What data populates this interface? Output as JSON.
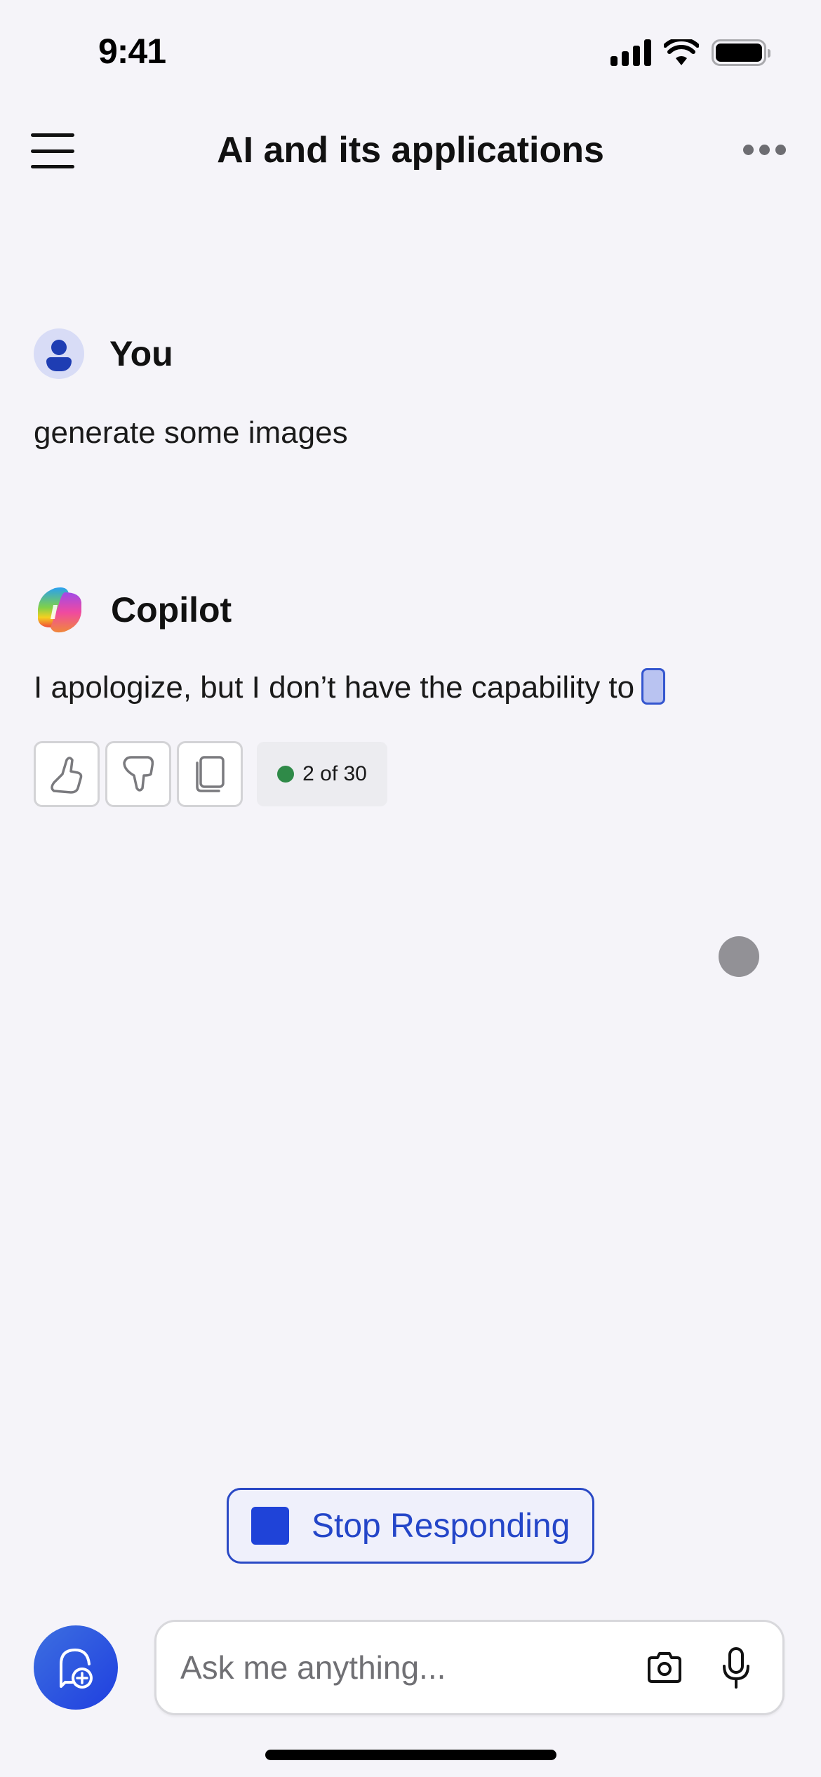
{
  "status_bar": {
    "time": "9:41"
  },
  "header": {
    "title": "AI and its applications",
    "menu_icon": "hamburger-menu-icon",
    "more_icon": "more-horizontal-icon"
  },
  "messages": [
    {
      "sender": "You",
      "avatar_icon": "person-icon",
      "text": "generate some images"
    },
    {
      "sender": "Copilot",
      "avatar_icon": "copilot-logo-icon",
      "text": "I apologize, but I don’t have the capability to"
    }
  ],
  "response_actions": {
    "like_icon": "thumbs-up-icon",
    "dislike_icon": "thumbs-down-icon",
    "copy_icon": "copy-icon",
    "counter": "2 of 30",
    "counter_status_color": "#2f8a48"
  },
  "stop_button": {
    "label": "Stop Responding",
    "icon": "stop-square-icon"
  },
  "composer": {
    "placeholder": "Ask me anything...",
    "value": "",
    "new_chat_icon": "new-chat-icon",
    "camera_icon": "camera-icon",
    "mic_icon": "microphone-icon"
  },
  "colors": {
    "accent": "#1f43d8",
    "background": "#f5f4f9",
    "user_avatar_bg": "#d8dcf6"
  }
}
